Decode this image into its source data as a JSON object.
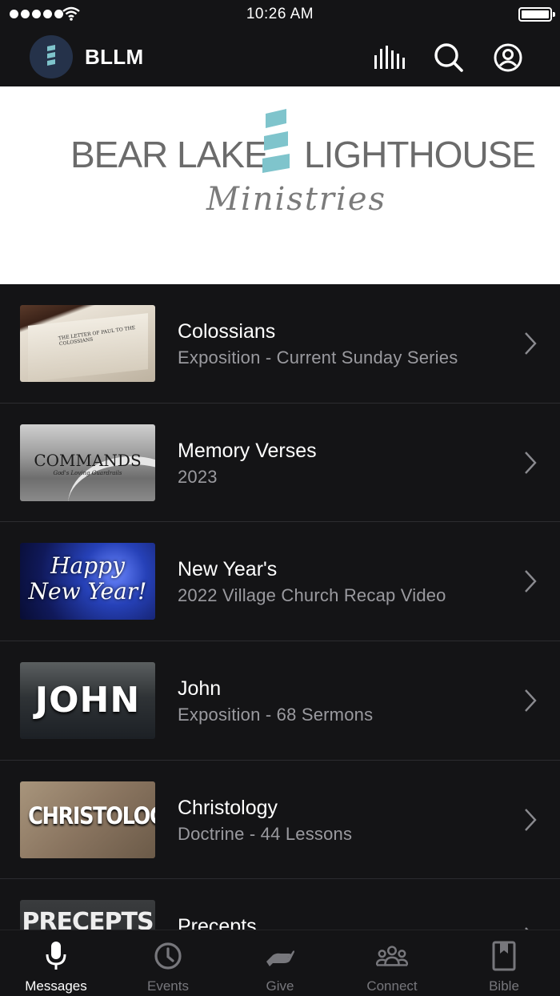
{
  "status_bar": {
    "time": "10:26 AM"
  },
  "header": {
    "title": "BLLM",
    "icons": [
      "equalizer-icon",
      "search-icon",
      "account-icon"
    ]
  },
  "banner": {
    "left_text": "BEAR LAKE",
    "right_text": "LIGHTHOUSE",
    "script_text": "Ministries"
  },
  "series": [
    {
      "title": "Colossians",
      "subtitle": "Exposition - Current Sunday Series",
      "thumb": {
        "caption": "THE LETTER OF PAUL TO THE COLOSSIANS"
      }
    },
    {
      "title": "Memory Verses",
      "subtitle": "2023",
      "thumb": {
        "caption": "COMMANDS",
        "caption2": "God's Loving Guardrails"
      }
    },
    {
      "title": "New Year's",
      "subtitle": "2022 Village Church Recap Video",
      "thumb": {
        "caption": "Happy",
        "caption2": "New Year!"
      }
    },
    {
      "title": "John",
      "subtitle": "Exposition - 68 Sermons",
      "thumb": {
        "caption": "JOHN"
      }
    },
    {
      "title": "Christology",
      "subtitle": "Doctrine - 44 Lessons",
      "thumb": {
        "caption": "CHRISTOLOGY"
      }
    },
    {
      "title": "Precepts",
      "subtitle": "",
      "thumb": {
        "caption": "PRECEPTS"
      }
    }
  ],
  "tabs": [
    {
      "label": "Messages",
      "icon": "microphone-icon",
      "active": true
    },
    {
      "label": "Events",
      "icon": "clock-icon",
      "active": false
    },
    {
      "label": "Give",
      "icon": "hand-icon",
      "active": false
    },
    {
      "label": "Connect",
      "icon": "people-icon",
      "active": false
    },
    {
      "label": "Bible",
      "icon": "book-icon",
      "active": false
    }
  ],
  "colors": {
    "background": "#141416",
    "accent": "#7fc4cc",
    "inactive": "#77777c"
  }
}
